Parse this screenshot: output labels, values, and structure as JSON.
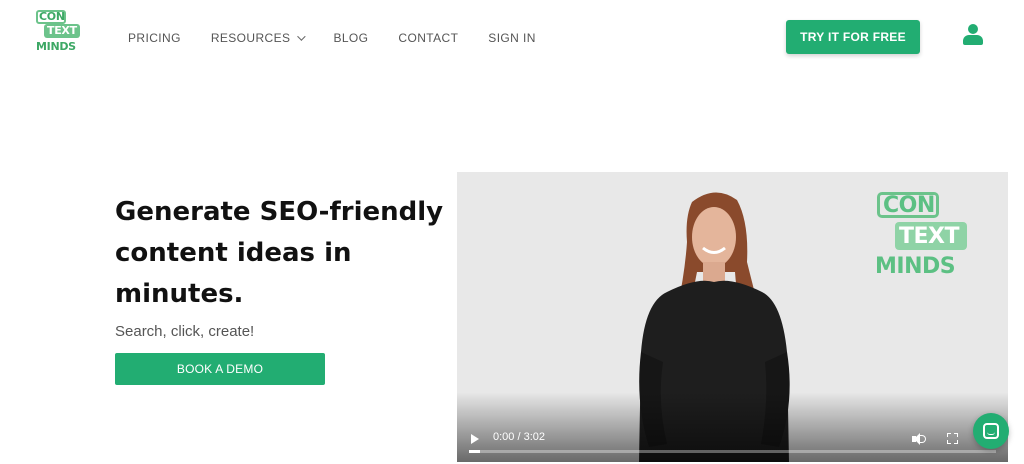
{
  "header": {
    "logo": {
      "line1": "CON",
      "line2": "TEXT",
      "line3": "MINDS"
    },
    "nav": [
      {
        "label": "PRICING"
      },
      {
        "label": "RESOURCES",
        "has_dropdown": true
      },
      {
        "label": "BLOG"
      },
      {
        "label": "CONTACT"
      },
      {
        "label": "SIGN IN"
      }
    ],
    "cta_label": "TRY IT FOR FREE",
    "user_icon": "user-icon"
  },
  "hero": {
    "headline": "Generate SEO-friendly content ideas in minutes.",
    "subtitle": "Search, click, create!",
    "demo_label": "BOOK A DEMO"
  },
  "video": {
    "logo": {
      "line1": "CON",
      "line2": "TEXT",
      "line3": "MINDS"
    },
    "time": "0:00 / 3:02",
    "progress": 0.0
  },
  "colors": {
    "accent": "#22ad72",
    "logo_green": "#6cc38b"
  }
}
